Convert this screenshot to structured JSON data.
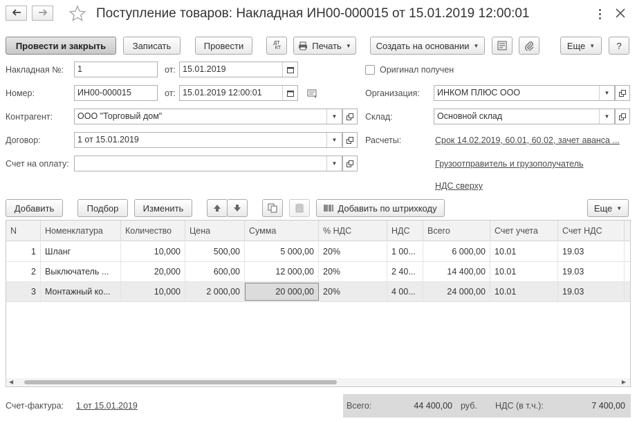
{
  "header": {
    "back_icon": "arrow-left-icon",
    "forward_icon": "arrow-right-icon",
    "star_icon": "star-icon",
    "title": "Поступление товаров: Накладная ИН00-000015 от 15.01.2019 12:00:01",
    "menu_icon": "kebab-icon",
    "close_icon": "close-icon"
  },
  "toolbar": {
    "post_close": "Провести и закрыть",
    "save": "Записать",
    "post": "Провести",
    "dt_kt": "ДТ\nКТ",
    "print": "Печать",
    "create_based": "Создать на основании",
    "more": "Еще",
    "help": "?"
  },
  "form": {
    "invoice_no_label": "Накладная №:",
    "invoice_no": "1",
    "from_label": "от:",
    "invoice_date": "15.01.2019",
    "original_label": "Оригинал получен",
    "original_checked": false,
    "number_label": "Номер:",
    "number": "ИН00-000015",
    "from_label2": "от:",
    "number_date": "15.01.2019 12:00:01",
    "org_label": "Организация:",
    "org": "ИНКОМ ПЛЮС ООО",
    "counterparty_label": "Контрагент:",
    "counterparty": "ООО \"Торговый дом\"",
    "warehouse_label": "Склад:",
    "warehouse": "Основной склад",
    "contract_label": "Договор:",
    "contract": "1 от 15.01.2019",
    "settlements_label": "Расчеты:",
    "settlements": "Срок 14.02.2019, 60.01, 60.02, зачет аванса ...",
    "payment_label": "Счет на оплату:",
    "payment": "",
    "shipper_link": "Грузоотправитель и грузополучатель",
    "vat_link": "НДС сверху"
  },
  "table_toolbar": {
    "add": "Добавить",
    "pick": "Подбор",
    "edit": "Изменить",
    "barcode": "Добавить по штрихкоду",
    "more": "Еще"
  },
  "table": {
    "columns": [
      "N",
      "Номенклатура",
      "Количество",
      "Цена",
      "Сумма",
      "% НДС",
      "НДС",
      "Всего",
      "Счет учета",
      "Счет НДС"
    ],
    "rows": [
      {
        "n": "1",
        "item": "Шланг",
        "qty": "10,000",
        "price": "500,00",
        "sum": "5 000,00",
        "vat_rate": "20%",
        "vat": "1 00...",
        "total": "6 000,00",
        "account": "10.01",
        "vat_account": "19.03"
      },
      {
        "n": "2",
        "item": "Выключатель ...",
        "qty": "20,000",
        "price": "600,00",
        "sum": "12 000,00",
        "vat_rate": "20%",
        "vat": "2 40...",
        "total": "14 400,00",
        "account": "10.01",
        "vat_account": "19.03"
      },
      {
        "n": "3",
        "item": "Монтажный ко...",
        "qty": "10,000",
        "price": "2 000,00",
        "sum": "20 000,00",
        "vat_rate": "20%",
        "vat": "4 00...",
        "total": "24 000,00",
        "account": "10.01",
        "vat_account": "19.03"
      }
    ]
  },
  "footer": {
    "invoice_label": "Счет-фактура:",
    "invoice_link": "1 от 15.01.2019",
    "total_label": "Всего:",
    "total": "44 400,00",
    "currency": "руб.",
    "vat_label": "НДС (в т.ч.):",
    "vat": "7 400,00"
  }
}
